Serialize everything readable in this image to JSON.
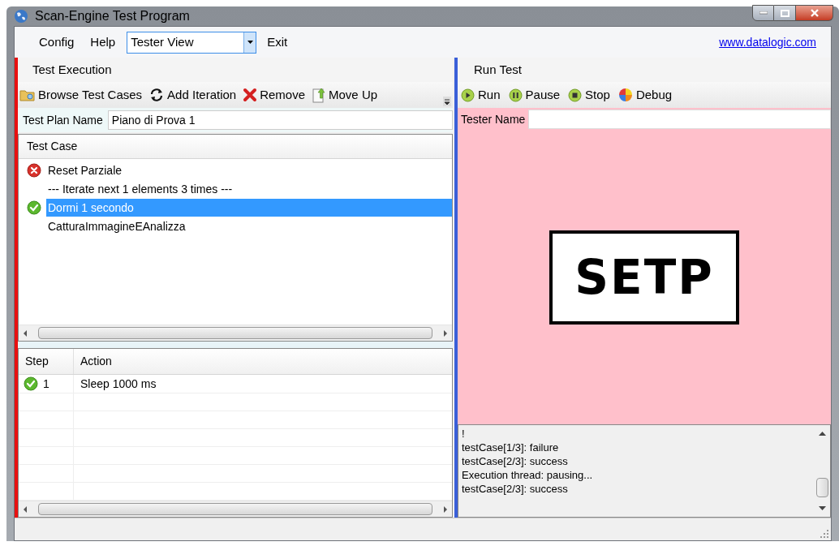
{
  "window": {
    "title": "Scan-Engine Test Program"
  },
  "menu": {
    "items": [
      "Config",
      "Help"
    ],
    "view_select": {
      "value": "Tester View"
    },
    "exit": "Exit",
    "link": "www.datalogic.com"
  },
  "test_execution": {
    "title": "Test Execution",
    "toolbar": [
      {
        "label": "Browse Test Cases",
        "kind": "folder"
      },
      {
        "label": "Add Iteration",
        "kind": "cycle"
      },
      {
        "label": "Remove",
        "kind": "cross"
      },
      {
        "label": "Move Up",
        "kind": "up"
      }
    ],
    "plan_name": {
      "label": "Test Plan Name",
      "value": "Piano di Prova 1"
    },
    "test_cases": {
      "column": "Test Case",
      "items": [
        {
          "label": "Reset Parziale",
          "kind": "failed",
          "selected": false
        },
        {
          "label": "--- Iterate next 1 elements 3 times ---",
          "kind": "plain",
          "selected": false
        },
        {
          "label": "Dormi 1 secondo",
          "kind": "passed",
          "selected": true
        },
        {
          "label": "CatturaImmagineEAnalizza",
          "kind": "plain",
          "selected": false
        }
      ]
    },
    "steps": {
      "columns": [
        "Step",
        "Action"
      ],
      "rows": [
        {
          "step": "1",
          "action": "Sleep 1000 ms",
          "kind": "passed"
        }
      ]
    }
  },
  "run_test": {
    "title": "Run Test",
    "toolbar": [
      {
        "label": "Run",
        "kind": "play"
      },
      {
        "label": "Pause",
        "kind": "pause"
      },
      {
        "label": "Stop",
        "kind": "stop"
      },
      {
        "label": "Debug",
        "kind": "debug"
      }
    ],
    "tester_name": {
      "label": "Tester Name"
    },
    "display_text": "SETP",
    "log": [
      "!",
      "testCase[1/3]: failure",
      "testCase[2/3]: success",
      "Execution thread: pausing...",
      "testCase[2/3]: success"
    ]
  }
}
